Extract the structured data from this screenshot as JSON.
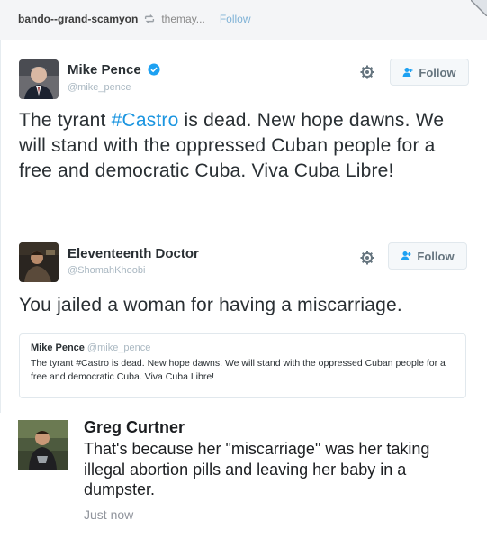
{
  "header": {
    "username": "bando--grand-scamyon",
    "reblogged_from": "themay...",
    "follow_label": "Follow"
  },
  "tweet": {
    "author_name": "Mike Pence",
    "author_handle": "@mike_pence",
    "follow_label": "Follow",
    "text_before": "The tyrant ",
    "hashtag": "#Castro",
    "text_after": " is dead. New hope dawns. We will stand with the oppressed Cuban people for a free and democratic Cuba. Viva Cuba Libre!"
  },
  "reply": {
    "author_name": "Eleventeenth Doctor",
    "author_handle": "@ShomahKhoobi",
    "follow_label": "Follow",
    "text": "You jailed a woman for having a miscarriage.",
    "quote": {
      "author_name": "Mike Pence",
      "author_handle": "@mike_pence",
      "text": "The tyrant #Castro is dead. New hope dawns. We will stand with the oppressed Cuban people for a free and democratic Cuba. Viva Cuba Libre!"
    }
  },
  "comment": {
    "author_name": "Greg Curtner",
    "text": "That's because her \"miscarriage\" was her taking illegal abortion pills and leaving her baby in a dumpster.",
    "timestamp": "Just now"
  },
  "colors": {
    "hashtag": "#1b95e0",
    "verified": "#1da1f2",
    "header_bg": "#f4f5f7",
    "tumblr_follow": "#7fb2d6"
  },
  "icons": [
    "reblog-icon",
    "verified-badge-icon",
    "gear-icon",
    "add-person-icon"
  ]
}
